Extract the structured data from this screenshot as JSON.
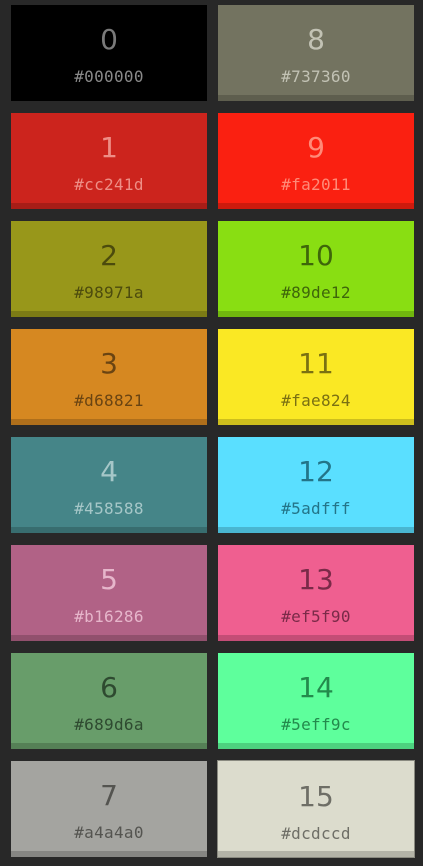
{
  "swatches": [
    {
      "index": "0",
      "hex": "#000000",
      "color": "#000000",
      "text_color": "#7a7a7a",
      "hex_color": "#8a8a8a"
    },
    {
      "index": "8",
      "hex": "#737360",
      "color": "#737360",
      "text_color": "#c2c2b4",
      "hex_color": "#c2c2b4"
    },
    {
      "index": "1",
      "hex": "#cc241d",
      "color": "#cc241d",
      "text_color": "#ee8e86",
      "hex_color": "#ee8e86"
    },
    {
      "index": "9",
      "hex": "#fa2011",
      "color": "#fa2011",
      "text_color": "#ff8a78",
      "hex_color": "#ff8a78"
    },
    {
      "index": "2",
      "hex": "#98971a",
      "color": "#98971a",
      "text_color": "#4c4b0d",
      "hex_color": "#4c4b0d"
    },
    {
      "index": "10",
      "hex": "#89de12",
      "color": "#89de12",
      "text_color": "#3e660a",
      "hex_color": "#3e660a"
    },
    {
      "index": "3",
      "hex": "#d68821",
      "color": "#d68821",
      "text_color": "#6a4412",
      "hex_color": "#6a4412"
    },
    {
      "index": "11",
      "hex": "#fae824",
      "color": "#fae824",
      "text_color": "#7a7012",
      "hex_color": "#7a7012"
    },
    {
      "index": "4",
      "hex": "#458588",
      "color": "#458588",
      "text_color": "#a6c7c8",
      "hex_color": "#a6c7c8"
    },
    {
      "index": "12",
      "hex": "#5adfff",
      "color": "#5adfff",
      "text_color": "#237488",
      "hex_color": "#237488"
    },
    {
      "index": "5",
      "hex": "#b16286",
      "color": "#b16286",
      "text_color": "#e6b6cb",
      "hex_color": "#e6b6cb"
    },
    {
      "index": "13",
      "hex": "#ef5f90",
      "color": "#ef5f90",
      "text_color": "#7a2a48",
      "hex_color": "#7a2a48"
    },
    {
      "index": "6",
      "hex": "#689d6a",
      "color": "#689d6a",
      "text_color": "#2e4a30",
      "hex_color": "#2e4a30"
    },
    {
      "index": "14",
      "hex": "#5eff9c",
      "color": "#5eff9c",
      "text_color": "#238a4c",
      "hex_color": "#238a4c"
    },
    {
      "index": "7",
      "hex": "#a4a4a0",
      "color": "#a4a4a0",
      "text_color": "#545450",
      "hex_color": "#545450"
    },
    {
      "index": "15",
      "hex": "#dcdccd",
      "color": "#dcdccd",
      "text_color": "#6e6e66",
      "hex_color": "#6e6e66"
    }
  ]
}
